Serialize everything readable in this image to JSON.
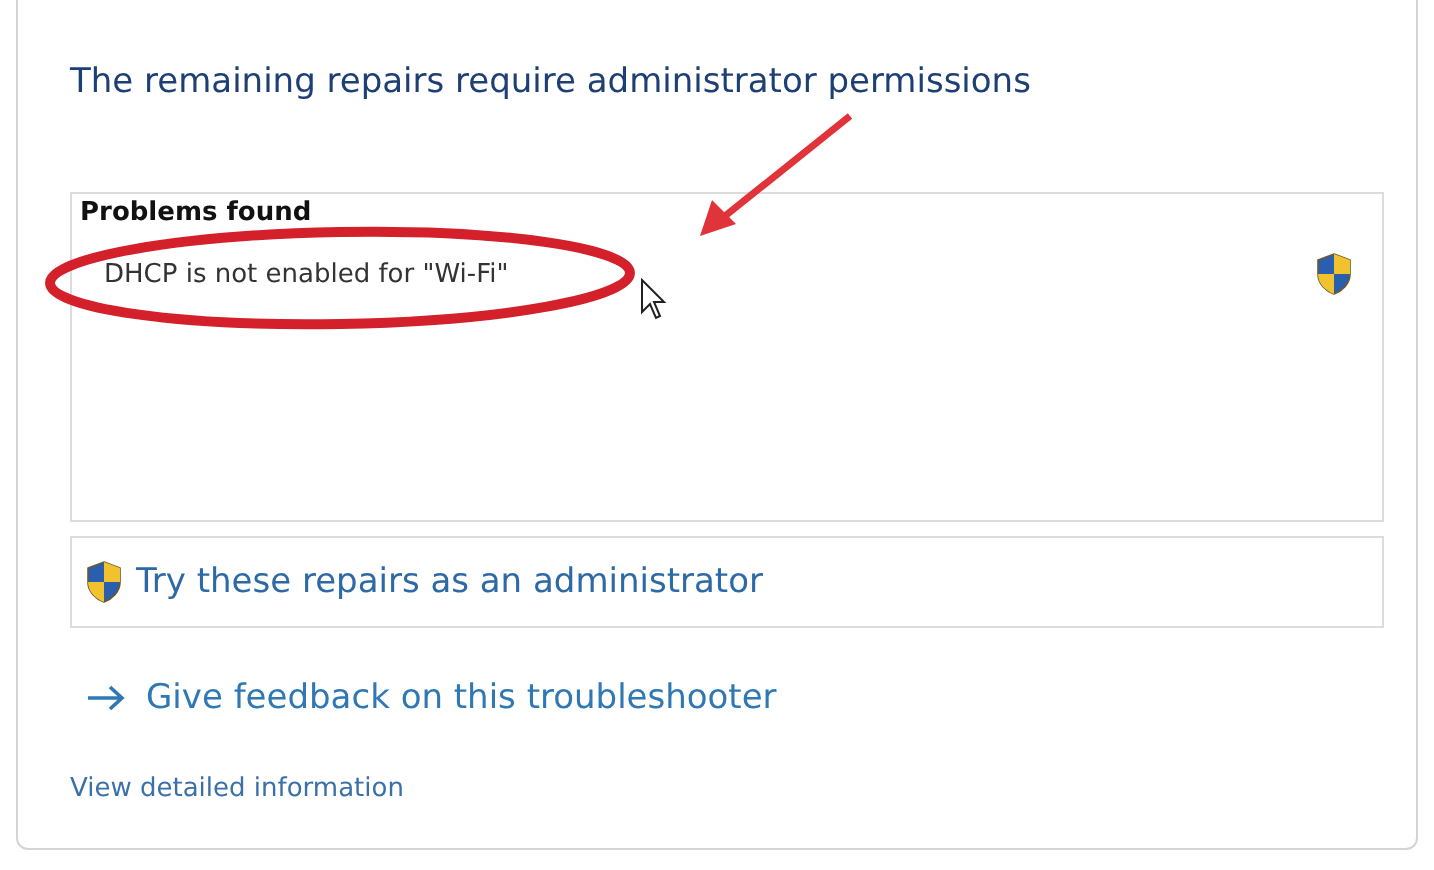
{
  "heading": "The remaining repairs require administrator permissions",
  "problems": {
    "title": "Problems found",
    "items": [
      {
        "text": "DHCP is not enabled for \"Wi-Fi\"",
        "admin": true
      }
    ]
  },
  "repair_button": {
    "label": "Try these repairs as an administrator",
    "admin": true
  },
  "feedback_link": "Give feedback on this troubleshooter",
  "details_link": "View detailed information"
}
